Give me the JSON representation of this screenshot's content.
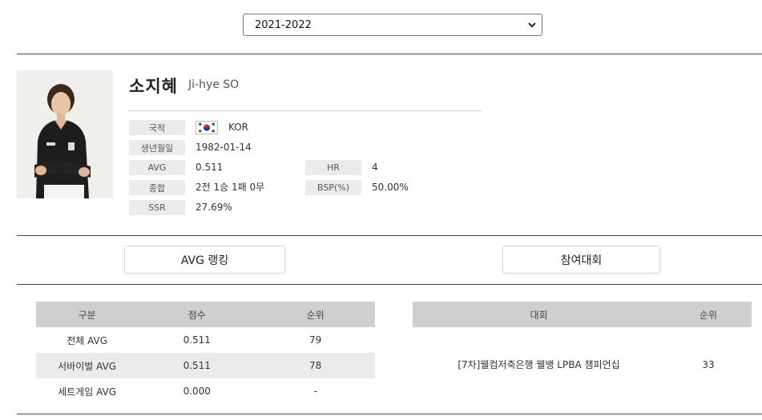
{
  "season_select": {
    "selected": "2021-2022"
  },
  "player": {
    "name_ko": "소지혜",
    "name_en": "Ji-hye SO",
    "nationality_label": "국적",
    "nationality_value": "KOR",
    "flag_icon": "south-korea-flag-icon",
    "birth_label": "생년월일",
    "birth_value": "1982-01-14",
    "avg_label": "AVG",
    "avg_value": "0.511",
    "hr_label": "HR",
    "hr_value": "4",
    "record_label": "종합",
    "record_value": "2전 1승 1패 0무",
    "bsp_label": "BSP(%)",
    "bsp_value": "50.00%",
    "ssr_label": "SSR",
    "ssr_value": "27.69%"
  },
  "tabs": {
    "avg_ranking": "AVG 랭킹",
    "tournaments": "참여대회"
  },
  "avg_table": {
    "headers": [
      "구분",
      "점수",
      "순위"
    ],
    "rows": [
      [
        "전체 AVG",
        "0.511",
        "79"
      ],
      [
        "서바이벌 AVG",
        "0.511",
        "78"
      ],
      [
        "세트게임 AVG",
        "0.000",
        "-"
      ]
    ]
  },
  "tournament_table": {
    "headers": [
      "대회",
      "순위"
    ],
    "rows": [
      [
        "[7차]웰컴저축은행 웰뱅 LPBA 챔피언십",
        "33"
      ]
    ]
  },
  "colors": {
    "rule": "#2f4f6f",
    "label_bg": "#ebebeb",
    "table_header_bg": "#cfcfcf"
  }
}
